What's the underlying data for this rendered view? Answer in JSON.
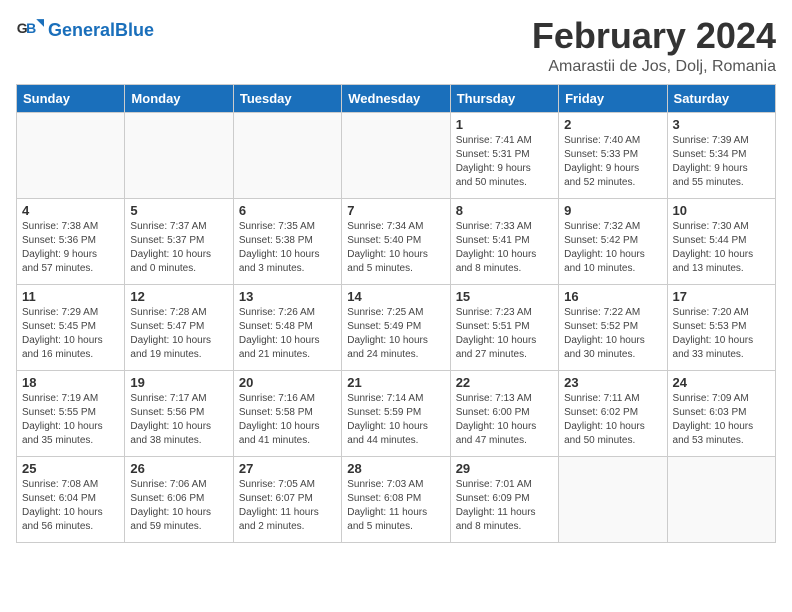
{
  "app": {
    "name": "GeneralBlue",
    "logo_text_1": "General",
    "logo_text_2": "Blue"
  },
  "calendar": {
    "month": "February 2024",
    "location": "Amarastii de Jos, Dolj, Romania",
    "days_of_week": [
      "Sunday",
      "Monday",
      "Tuesday",
      "Wednesday",
      "Thursday",
      "Friday",
      "Saturday"
    ],
    "weeks": [
      [
        {
          "day": "",
          "info": ""
        },
        {
          "day": "",
          "info": ""
        },
        {
          "day": "",
          "info": ""
        },
        {
          "day": "",
          "info": ""
        },
        {
          "day": "1",
          "info": "Sunrise: 7:41 AM\nSunset: 5:31 PM\nDaylight: 9 hours\nand 50 minutes."
        },
        {
          "day": "2",
          "info": "Sunrise: 7:40 AM\nSunset: 5:33 PM\nDaylight: 9 hours\nand 52 minutes."
        },
        {
          "day": "3",
          "info": "Sunrise: 7:39 AM\nSunset: 5:34 PM\nDaylight: 9 hours\nand 55 minutes."
        }
      ],
      [
        {
          "day": "4",
          "info": "Sunrise: 7:38 AM\nSunset: 5:36 PM\nDaylight: 9 hours\nand 57 minutes."
        },
        {
          "day": "5",
          "info": "Sunrise: 7:37 AM\nSunset: 5:37 PM\nDaylight: 10 hours\nand 0 minutes."
        },
        {
          "day": "6",
          "info": "Sunrise: 7:35 AM\nSunset: 5:38 PM\nDaylight: 10 hours\nand 3 minutes."
        },
        {
          "day": "7",
          "info": "Sunrise: 7:34 AM\nSunset: 5:40 PM\nDaylight: 10 hours\nand 5 minutes."
        },
        {
          "day": "8",
          "info": "Sunrise: 7:33 AM\nSunset: 5:41 PM\nDaylight: 10 hours\nand 8 minutes."
        },
        {
          "day": "9",
          "info": "Sunrise: 7:32 AM\nSunset: 5:42 PM\nDaylight: 10 hours\nand 10 minutes."
        },
        {
          "day": "10",
          "info": "Sunrise: 7:30 AM\nSunset: 5:44 PM\nDaylight: 10 hours\nand 13 minutes."
        }
      ],
      [
        {
          "day": "11",
          "info": "Sunrise: 7:29 AM\nSunset: 5:45 PM\nDaylight: 10 hours\nand 16 minutes."
        },
        {
          "day": "12",
          "info": "Sunrise: 7:28 AM\nSunset: 5:47 PM\nDaylight: 10 hours\nand 19 minutes."
        },
        {
          "day": "13",
          "info": "Sunrise: 7:26 AM\nSunset: 5:48 PM\nDaylight: 10 hours\nand 21 minutes."
        },
        {
          "day": "14",
          "info": "Sunrise: 7:25 AM\nSunset: 5:49 PM\nDaylight: 10 hours\nand 24 minutes."
        },
        {
          "day": "15",
          "info": "Sunrise: 7:23 AM\nSunset: 5:51 PM\nDaylight: 10 hours\nand 27 minutes."
        },
        {
          "day": "16",
          "info": "Sunrise: 7:22 AM\nSunset: 5:52 PM\nDaylight: 10 hours\nand 30 minutes."
        },
        {
          "day": "17",
          "info": "Sunrise: 7:20 AM\nSunset: 5:53 PM\nDaylight: 10 hours\nand 33 minutes."
        }
      ],
      [
        {
          "day": "18",
          "info": "Sunrise: 7:19 AM\nSunset: 5:55 PM\nDaylight: 10 hours\nand 35 minutes."
        },
        {
          "day": "19",
          "info": "Sunrise: 7:17 AM\nSunset: 5:56 PM\nDaylight: 10 hours\nand 38 minutes."
        },
        {
          "day": "20",
          "info": "Sunrise: 7:16 AM\nSunset: 5:58 PM\nDaylight: 10 hours\nand 41 minutes."
        },
        {
          "day": "21",
          "info": "Sunrise: 7:14 AM\nSunset: 5:59 PM\nDaylight: 10 hours\nand 44 minutes."
        },
        {
          "day": "22",
          "info": "Sunrise: 7:13 AM\nSunset: 6:00 PM\nDaylight: 10 hours\nand 47 minutes."
        },
        {
          "day": "23",
          "info": "Sunrise: 7:11 AM\nSunset: 6:02 PM\nDaylight: 10 hours\nand 50 minutes."
        },
        {
          "day": "24",
          "info": "Sunrise: 7:09 AM\nSunset: 6:03 PM\nDaylight: 10 hours\nand 53 minutes."
        }
      ],
      [
        {
          "day": "25",
          "info": "Sunrise: 7:08 AM\nSunset: 6:04 PM\nDaylight: 10 hours\nand 56 minutes."
        },
        {
          "day": "26",
          "info": "Sunrise: 7:06 AM\nSunset: 6:06 PM\nDaylight: 10 hours\nand 59 minutes."
        },
        {
          "day": "27",
          "info": "Sunrise: 7:05 AM\nSunset: 6:07 PM\nDaylight: 11 hours\nand 2 minutes."
        },
        {
          "day": "28",
          "info": "Sunrise: 7:03 AM\nSunset: 6:08 PM\nDaylight: 11 hours\nand 5 minutes."
        },
        {
          "day": "29",
          "info": "Sunrise: 7:01 AM\nSunset: 6:09 PM\nDaylight: 11 hours\nand 8 minutes."
        },
        {
          "day": "",
          "info": ""
        },
        {
          "day": "",
          "info": ""
        }
      ]
    ]
  }
}
